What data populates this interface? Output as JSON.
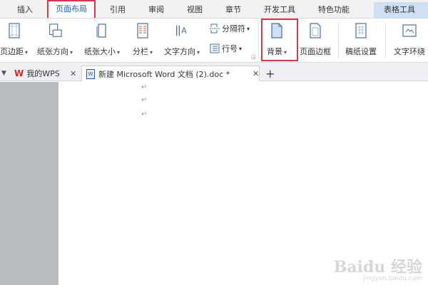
{
  "menu": {
    "tabs": [
      {
        "label": "插入"
      },
      {
        "label": "页面布局"
      },
      {
        "label": "引用"
      },
      {
        "label": "审阅"
      },
      {
        "label": "视图"
      },
      {
        "label": "章节"
      },
      {
        "label": "开发工具"
      },
      {
        "label": "特色功能"
      }
    ],
    "table_tools": "表格工具"
  },
  "ribbon": {
    "margins": "页边距",
    "orientation": "纸张方向",
    "size": "纸张大小",
    "columns": "分栏",
    "text_direction": "文字方向",
    "breaks": "分隔符",
    "line_numbers": "行号",
    "background": "背景",
    "page_border": "页面边框",
    "manuscript": "稿纸设置",
    "wrap_text": "文字环绕"
  },
  "doc_tabs": {
    "wps_home": "我的WPS",
    "document": "新建 Microsoft Word 文档 (2).doc *",
    "new_tab": "+"
  },
  "document": {
    "paragraph_mark": "↵"
  },
  "watermark": {
    "main": "Baidu 经验",
    "sub": "jingyan.baidu.com"
  },
  "colors": {
    "highlight": "#e0324b",
    "active_tab_text": "#1f5fb8",
    "table_tools_bg": "#cfe0f4",
    "wps_red": "#d7262c",
    "doc_blue": "#2b5db7"
  }
}
